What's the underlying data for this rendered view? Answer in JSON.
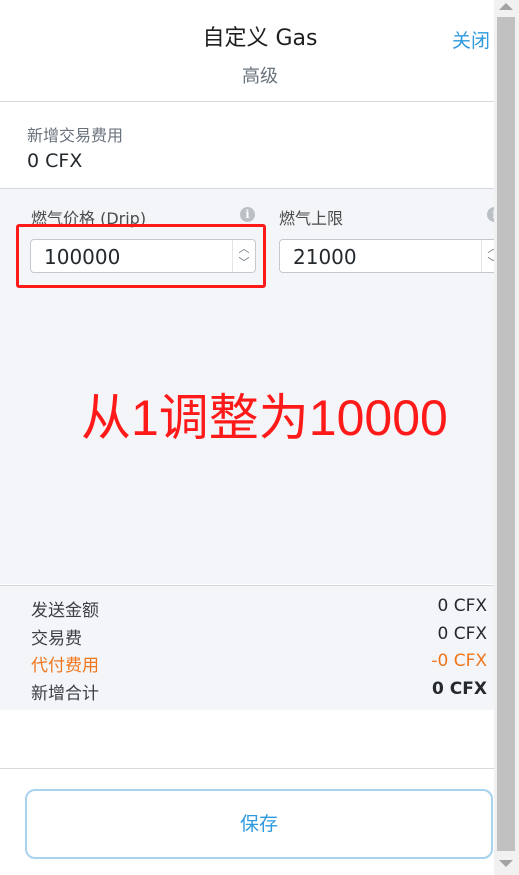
{
  "header": {
    "title": "自定义 Gas",
    "subtitle": "高级",
    "close_label": "关闭"
  },
  "new_fee": {
    "label": "新增交易费用",
    "value": "0 CFX"
  },
  "gas_price": {
    "label": "燃气价格 (Drip)",
    "value": "100000"
  },
  "gas_limit": {
    "label": "燃气上限",
    "value": "21000"
  },
  "annotation": "从1调整为10000",
  "summary": {
    "send_amount": {
      "label": "发送金额",
      "value": "0 CFX"
    },
    "tx_fee": {
      "label": "交易费",
      "value": "0 CFX"
    },
    "sponsored_fee": {
      "label": "代付费用",
      "value": "-0 CFX"
    },
    "total": {
      "label": "新增合计",
      "value": "0 CFX"
    }
  },
  "save_label": "保存",
  "colors": {
    "accent": "#2f9ae0",
    "highlight": "#ff1a1a",
    "sponsored": "#f0761c"
  }
}
